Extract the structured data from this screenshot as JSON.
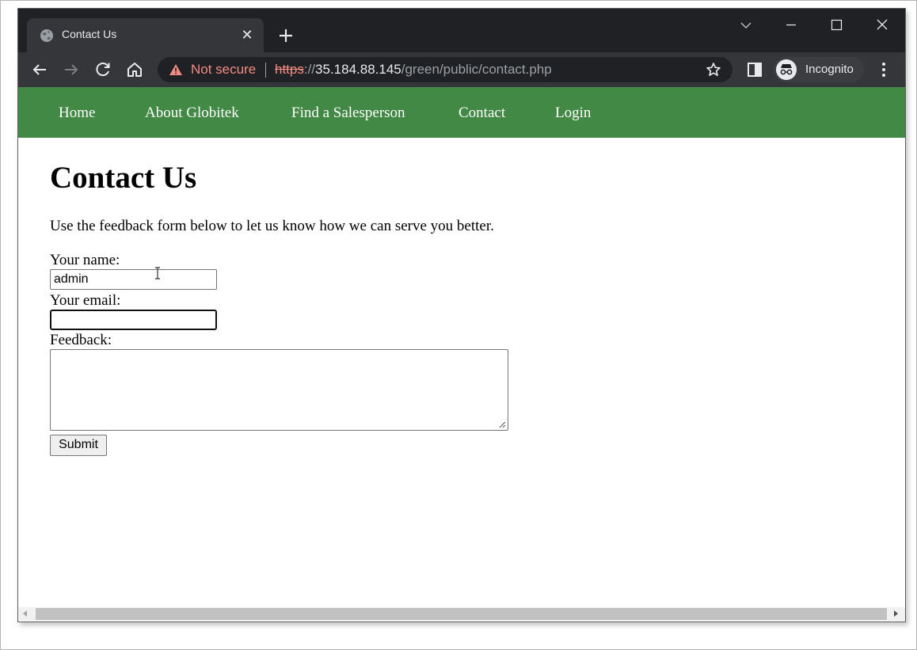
{
  "browser": {
    "tab_title": "Contact Us",
    "tab_close_glyph": "✕",
    "security_label": "Not secure",
    "url_scheme": "https",
    "url_separator": "://",
    "url_host": "35.184.88.145",
    "url_path": "/green/public/contact.php",
    "profile_label": "Incognito"
  },
  "nav": {
    "items": [
      {
        "label": "Home"
      },
      {
        "label": "About Globitek"
      },
      {
        "label": "Find a Salesperson"
      },
      {
        "label": "Contact"
      },
      {
        "label": "Login"
      }
    ],
    "background_color": "#428945"
  },
  "content": {
    "heading": "Contact Us",
    "intro": "Use the feedback form below to let us know how we can serve you better.",
    "form": {
      "name_label": "Your name:",
      "name_value": "admin",
      "email_label": "Your email:",
      "email_value": "",
      "feedback_label": "Feedback:",
      "feedback_value": "",
      "submit_label": "Submit"
    }
  },
  "icons": [
    "globe-icon",
    "close-icon",
    "plus-icon",
    "chevron-down-icon",
    "minimize-icon",
    "maximize-icon",
    "close-window-icon",
    "back-arrow-icon",
    "forward-arrow-icon",
    "reload-icon",
    "home-icon",
    "warning-icon",
    "star-icon",
    "side-panel-icon",
    "incognito-icon",
    "kebab-menu-icon",
    "text-cursor-icon"
  ],
  "colors": {
    "not_secure": "#f28b82",
    "tabstrip": "#202124",
    "toolbar": "#35363a"
  }
}
